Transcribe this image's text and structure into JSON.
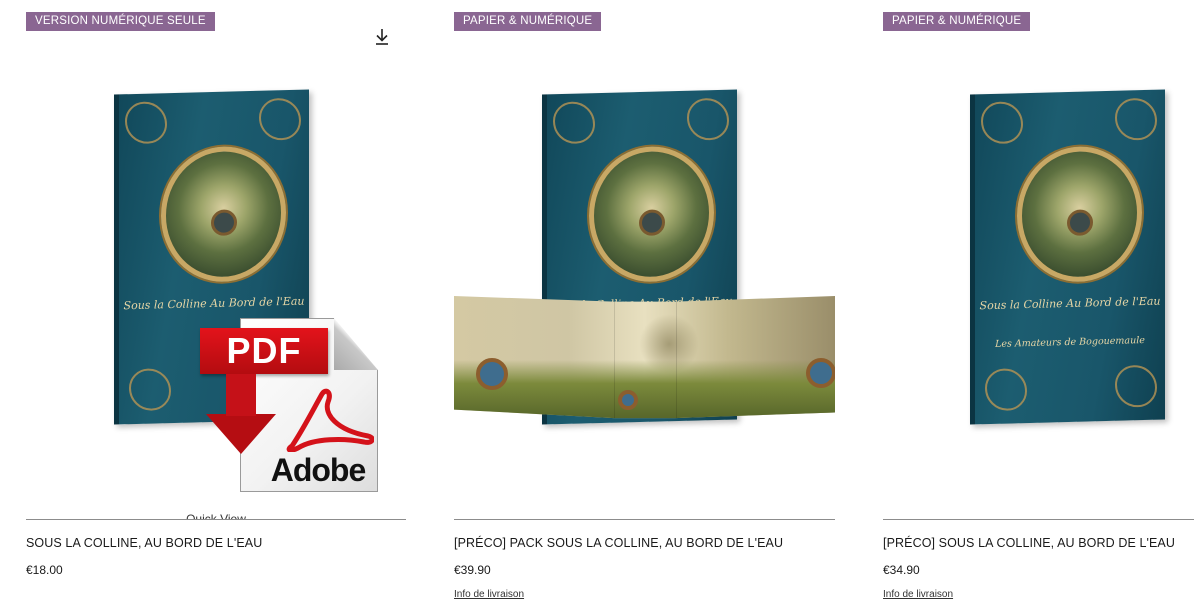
{
  "products": [
    {
      "ribbon": "VERSION NUMÉRIQUE SEULE",
      "title": "SOUS LA COLLINE, AU BORD DE L'EAU",
      "price": "€18.00",
      "quick_view": "Quick View",
      "shipping": "",
      "cover_title": "Sous la Colline Au Bord de l'Eau",
      "pdf_badge": "PDF",
      "pdf_brand": "Adobe"
    },
    {
      "ribbon": "PAPIER & NUMÉRIQUE",
      "title": "[PRÉCO] PACK SOUS LA COLLINE, AU BORD DE L'EAU",
      "price": "€39.90",
      "shipping": "Info de livraison",
      "cover_title": "Sous la Colline Au Bord de l'Eau"
    },
    {
      "ribbon": "PAPIER & NUMÉRIQUE",
      "title": "[PRÉCO] SOUS LA COLLINE, AU BORD DE L'EAU",
      "price": "€34.90",
      "shipping": "Info de livraison",
      "cover_title": "Sous la Colline Au Bord de l'Eau",
      "cover_subtitle": "Les Amateurs de Bogouemaule"
    }
  ],
  "icons": {
    "download": "download-icon"
  },
  "colors": {
    "ribbon": "#8a6692",
    "divider": "#8c8c8c",
    "book_cover": "#19566a",
    "pdf_red": "#d4121a"
  }
}
